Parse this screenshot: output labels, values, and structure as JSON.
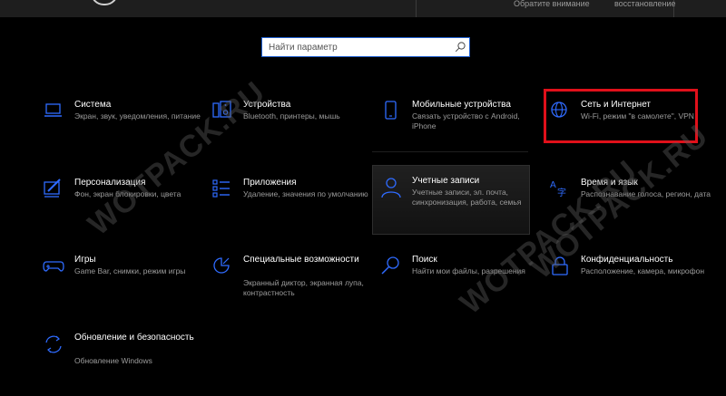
{
  "topbar": {
    "hint_left": "Обратите внимание",
    "hint_right": "восстановление"
  },
  "search": {
    "placeholder": "Найти параметр"
  },
  "colors": {
    "accent": "#1f5fcf",
    "highlight": "#e0101a",
    "background": "#000000"
  },
  "tiles": [
    {
      "icon": "laptop-icon",
      "title": "Система",
      "description": "Экран, звук, уведомления, питание"
    },
    {
      "icon": "devices-icon",
      "title": "Устройства",
      "description": "Bluetooth, принтеры, мышь"
    },
    {
      "icon": "phone-icon",
      "title": "Мобильные устройства",
      "description": "Связать устройство с Android, iPhone"
    },
    {
      "icon": "globe-icon",
      "title": "Сеть и Интернет",
      "description": "Wi-Fi, режим \"в самолете\", VPN"
    },
    {
      "icon": "paintbrush-icon",
      "title": "Персонализация",
      "description": "Фон, экран блокировки, цвета"
    },
    {
      "icon": "apps-icon",
      "title": "Приложения",
      "description": "Удаление, значения по умолчанию"
    },
    {
      "icon": "person-icon",
      "title": "Учетные записи",
      "description": "Учетные записи, эл. почта, синхронизация, работа, семья"
    },
    {
      "icon": "language-icon",
      "title": "Время и язык",
      "description": "Распознавание голоса, регион, дата"
    },
    {
      "icon": "gamepad-icon",
      "title": "Игры",
      "description": "Game Bar, снимки, режим игры"
    },
    {
      "icon": "accessibility-icon",
      "title": "Специальные возможности",
      "description": "Экранный диктор, экранная лупа, контрастность"
    },
    {
      "icon": "search-icon",
      "title": "Поиск",
      "description": "Найти мои файлы, разрешения"
    },
    {
      "icon": "lock-icon",
      "title": "Конфиденциальность",
      "description": "Расположение, камера, микрофон"
    },
    {
      "icon": "sync-icon",
      "title": "Обновление и безопасность",
      "description": "Обновление Windows"
    }
  ],
  "watermarks": [
    "WOTPACK.RU",
    "WOTPACK.RU",
    "WOTPACK.RU"
  ]
}
